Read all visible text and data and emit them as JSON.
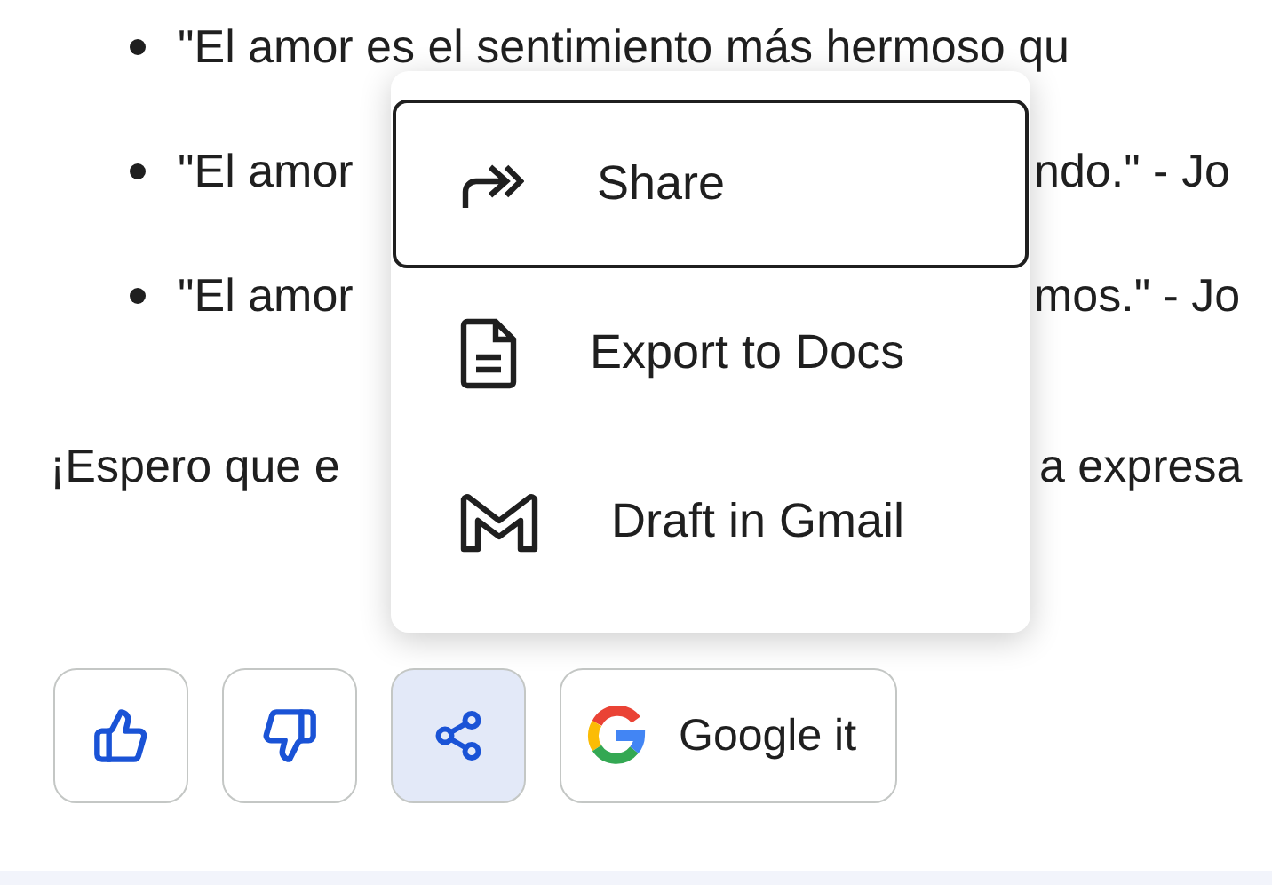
{
  "response": {
    "bullets": [
      {
        "text": "\"El amor es el sentimiento más hermoso qu"
      },
      {
        "text": "\"El amor",
        "text_after": "ndo.\" - Jo"
      },
      {
        "text": "\"El amor",
        "text_after": "mos.\" - Jo"
      }
    ],
    "paragraph": {
      "text": "¡Espero que e",
      "text_after": "a expresa"
    }
  },
  "actions": [
    {
      "kind": "like",
      "selected": false
    },
    {
      "kind": "dislike",
      "selected": false
    },
    {
      "kind": "share",
      "selected": true
    },
    {
      "kind": "search",
      "label": "Google it",
      "selected": false
    }
  ],
  "share_menu": {
    "items": [
      {
        "kind": "share",
        "label": "Share",
        "selected": true
      },
      {
        "kind": "docs",
        "label": "Export to Docs",
        "selected": false
      },
      {
        "kind": "gmail",
        "label": "Draft in Gmail",
        "selected": false
      }
    ]
  }
}
